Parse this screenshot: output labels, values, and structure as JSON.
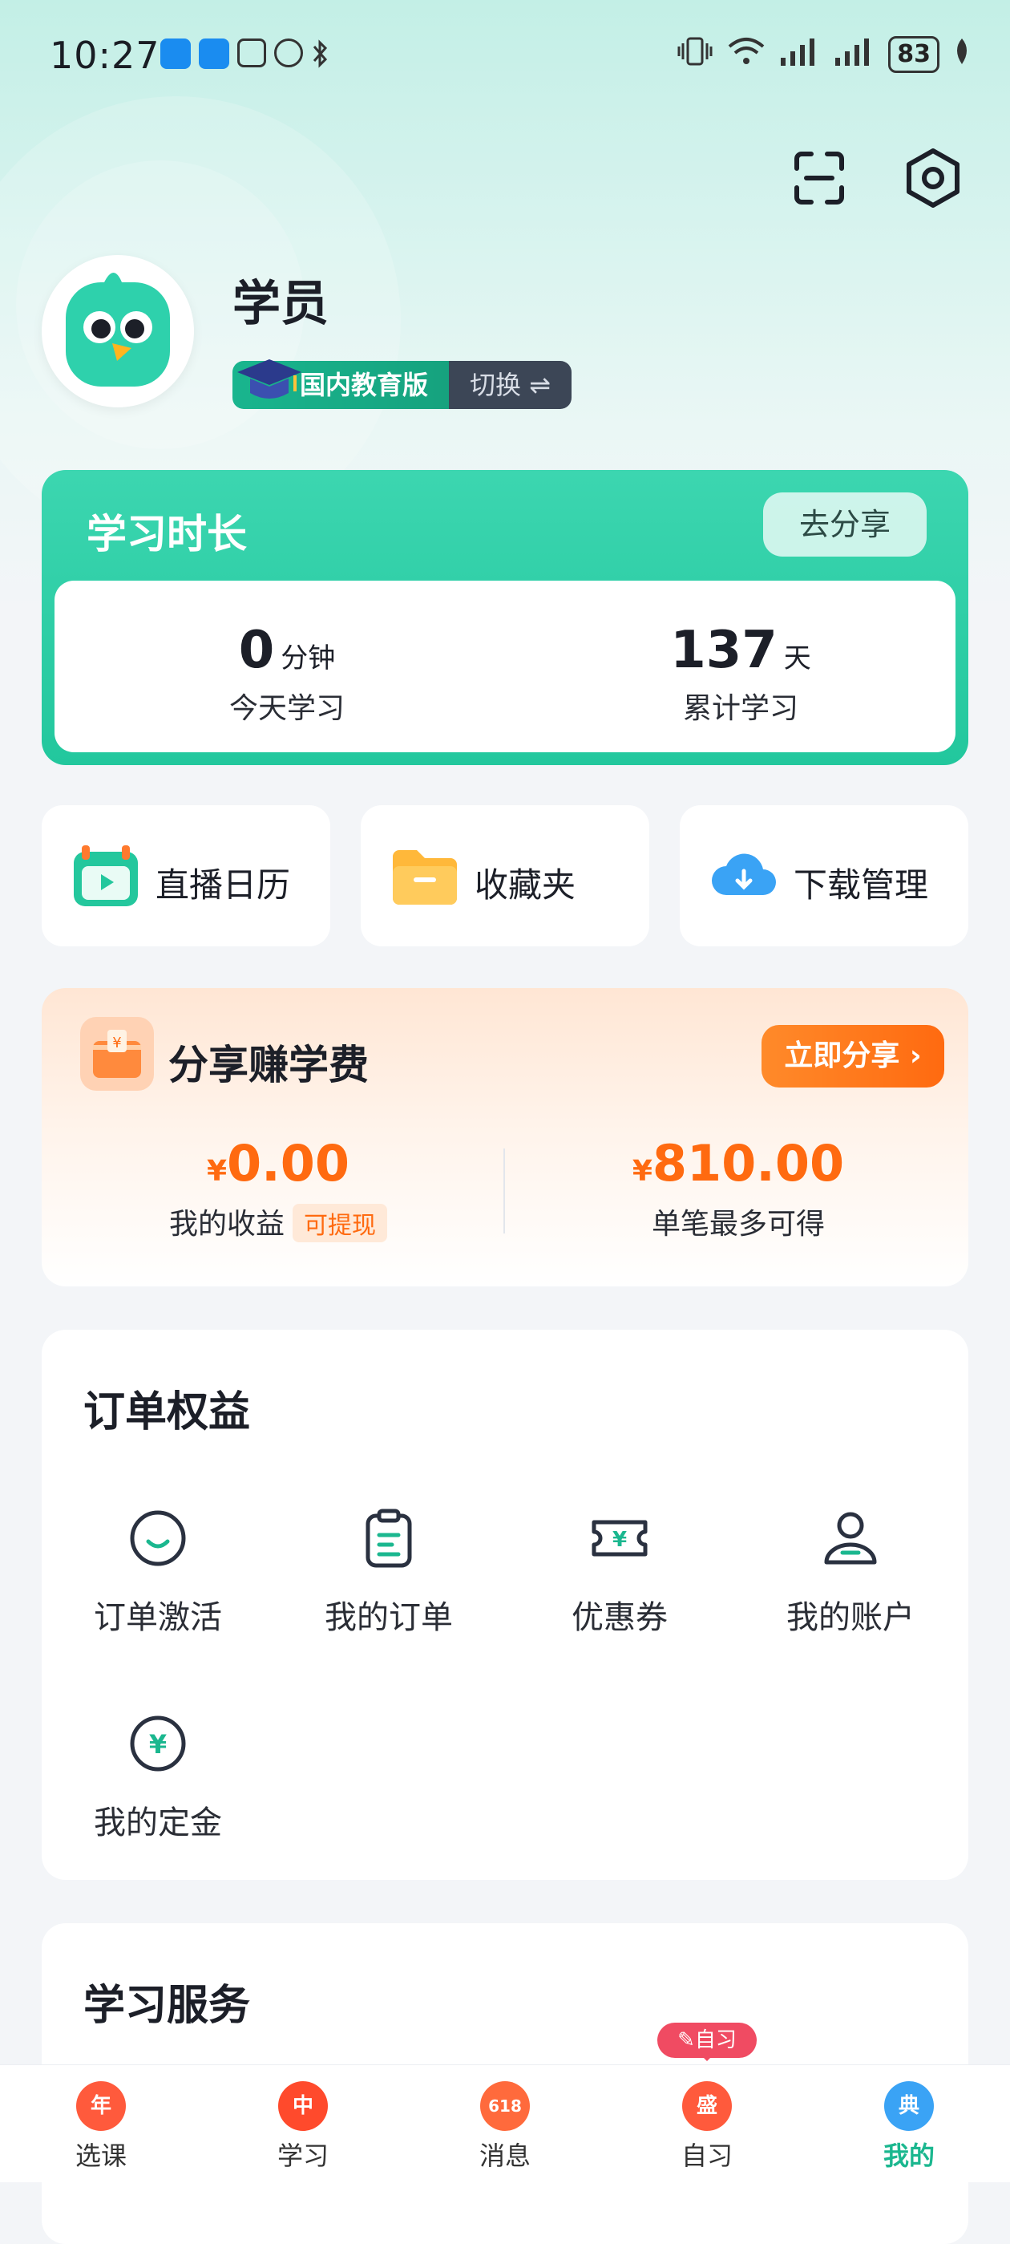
{
  "status_bar": {
    "time": "10:27",
    "battery": "83"
  },
  "profile": {
    "name": "学员",
    "edition": "国内教育版",
    "switch_label": "切换 ⇌"
  },
  "study_time": {
    "title": "学习时长",
    "share_label": "去分享",
    "today_value": "0",
    "today_unit": "分钟",
    "today_label": "今天学习",
    "total_value": "137",
    "total_unit": "天",
    "total_label": "累计学习"
  },
  "quick_links": [
    {
      "label": "直播日历",
      "icon": "calendar-icon"
    },
    {
      "label": "收藏夹",
      "icon": "folder-icon"
    },
    {
      "label": "下载管理",
      "icon": "cloud-download-icon"
    }
  ],
  "share_earn": {
    "title": "分享赚学费",
    "button": "立即分享 ›",
    "my_income_value": "0.00",
    "my_income_label": "我的收益",
    "withdraw_tag": "可提现",
    "max_value": "810.00",
    "max_label": "单笔最多可得",
    "currency": "¥"
  },
  "orders": {
    "title": "订单权益",
    "items": [
      {
        "label": "订单激活",
        "icon": "smile-icon"
      },
      {
        "label": "我的订单",
        "icon": "clipboard-icon"
      },
      {
        "label": "优惠券",
        "icon": "coupon-icon"
      },
      {
        "label": "我的账户",
        "icon": "user-icon"
      },
      {
        "label": "我的定金",
        "icon": "yuan-coin-icon"
      }
    ]
  },
  "services": {
    "title": "学习服务"
  },
  "bottom_nav": {
    "items": [
      {
        "label": "选课",
        "glyph": "年"
      },
      {
        "label": "学习",
        "glyph": "中"
      },
      {
        "label": "消息",
        "glyph": "618"
      },
      {
        "label": "自习",
        "glyph": "盛"
      },
      {
        "label": "我的",
        "glyph": "典"
      }
    ],
    "self_study_badge": "✎自习"
  },
  "colors": {
    "accent": "#1bb78f",
    "orange": "#ff6a10"
  }
}
